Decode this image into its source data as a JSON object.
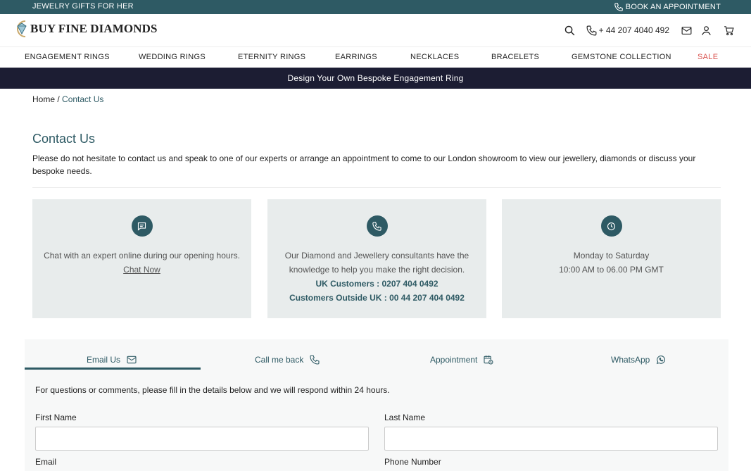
{
  "topbar": {
    "promo": "JEWELRY GIFTS FOR HER",
    "appointment": "BOOK AN APPOINTMENT"
  },
  "header": {
    "logo_text": "BUY FINE DIAMONDS",
    "phone": "+ 44 207 4040 492"
  },
  "nav": {
    "items": [
      "ENGAGEMENT RINGS",
      "WEDDING RINGS",
      "ETERNITY RINGS",
      "EARRINGS",
      "NECKLACES",
      "BRACELETS",
      "GEMSTONE COLLECTION",
      "SALE"
    ]
  },
  "banner": "Design Your Own Bespoke Engagement Ring",
  "breadcrumb": {
    "home": "Home",
    "separator": " / ",
    "current": "Contact Us"
  },
  "page": {
    "title": "Contact Us",
    "intro": "Please do not hesitate to contact us and speak to one of our experts or arrange an appointment to come to our London showroom to view our jewellery, diamonds or discuss your bespoke needs."
  },
  "cards": {
    "chat": {
      "icon": "chat-icon",
      "text": "Chat with an expert online during our opening hours.",
      "link": "Chat Now"
    },
    "phone": {
      "icon": "phone-icon",
      "text": "Our Diamond and Jewellery consultants have the knowledge to help you make the right decision.",
      "uk": "UK Customers : 0207 404 0492",
      "outside": "Customers Outside UK : 00 44 207 404 0492"
    },
    "hours": {
      "icon": "clock-icon",
      "days": "Monday to Saturday",
      "time": "10:00 AM to 06.00 PM GMT"
    }
  },
  "form": {
    "tabs": [
      "Email Us",
      "Call me back",
      "Appointment",
      "WhatsApp"
    ],
    "active_tab": "Email Us",
    "note": "For questions or comments, please fill in the details below and we will respond within 24 hours.",
    "first_name_label": "First Name",
    "last_name_label": "Last Name",
    "email_label": "Email",
    "phone_label": "Phone Number",
    "first_name_value": "",
    "last_name_value": ""
  },
  "colors": {
    "teal": "#2e5a64",
    "navy": "#1c1d33",
    "sale": "#d9534f",
    "card_bg": "#e8ecec"
  }
}
